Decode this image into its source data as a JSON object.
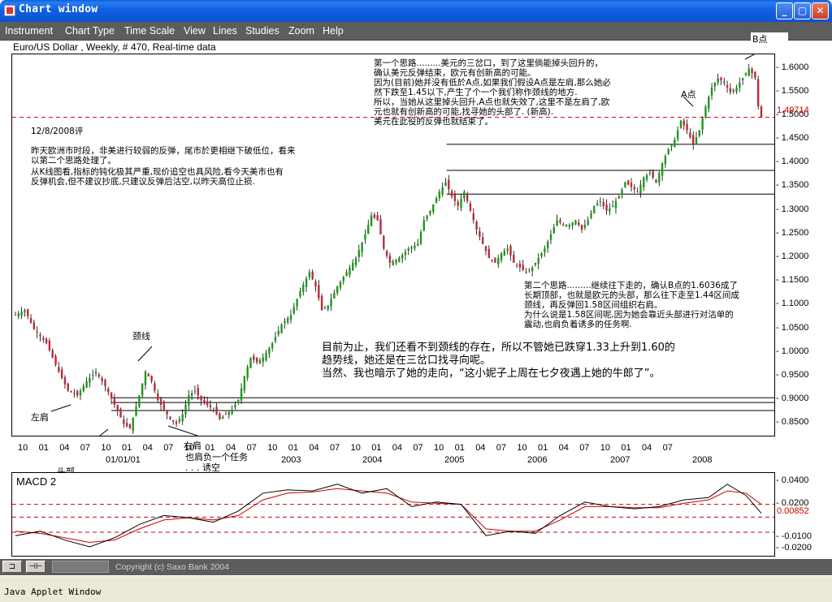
{
  "window": {
    "title": "Chart window",
    "minimize": "_",
    "maximize": "▢",
    "close": "✕"
  },
  "menu": [
    "Instrument",
    "Chart Type",
    "Time Scale",
    "View",
    "Lines",
    "Studies",
    "Zoom",
    "Help"
  ],
  "instrument_label": "Euro/US Dollar , Weekly, # 470, Real-time data",
  "chart_data": {
    "type": "candlestick",
    "instrument": "Euro/US Dollar",
    "period": "Weekly",
    "y_ticks": [
      "1.6000",
      "1.5500",
      "1.5000",
      "1.4500",
      "1.4000",
      "1.3500",
      "1.3000",
      "1.2500",
      "1.2000",
      "1.1500",
      "1.1000",
      "1.0500",
      "1.0000",
      "0.9500",
      "0.9000",
      "0.8500"
    ],
    "ylim": [
      0.825,
      1.63
    ],
    "current_price": "1.49714",
    "x_month_ticks": [
      "10",
      "01",
      "04",
      "07",
      "10",
      "01",
      "04",
      "07",
      "10",
      "01",
      "04",
      "07",
      "10",
      "01",
      "04",
      "07",
      "10",
      "01",
      "04",
      "07",
      "10",
      "01",
      "04",
      "07",
      "10",
      "01",
      "04",
      "07",
      "10",
      "01",
      "04",
      "07"
    ],
    "x_year_ticks": [
      "01/01/01",
      "2003",
      "2004",
      "2005",
      "2006",
      "2007",
      "2008"
    ],
    "x_range": [
      "2000-10",
      "2008-09"
    ],
    "price_path": [
      [
        0,
        1.08
      ],
      [
        3,
        1.09
      ],
      [
        6,
        1.05
      ],
      [
        10,
        1.02
      ],
      [
        14,
        0.96
      ],
      [
        17,
        0.92
      ],
      [
        20,
        0.91
      ],
      [
        23,
        0.94
      ],
      [
        26,
        0.96
      ],
      [
        29,
        0.93
      ],
      [
        32,
        0.89
      ],
      [
        35,
        0.85
      ],
      [
        37,
        0.84
      ],
      [
        40,
        0.91
      ],
      [
        42,
        0.96
      ],
      [
        44,
        0.94
      ],
      [
        46,
        0.9
      ],
      [
        48,
        0.88
      ],
      [
        50,
        0.86
      ],
      [
        52,
        0.85
      ],
      [
        54,
        0.87
      ],
      [
        56,
        0.91
      ],
      [
        58,
        0.92
      ],
      [
        60,
        0.9
      ],
      [
        62,
        0.89
      ],
      [
        64,
        0.88
      ],
      [
        66,
        0.86
      ],
      [
        68,
        0.87
      ],
      [
        70,
        0.88
      ],
      [
        72,
        0.9
      ],
      [
        74,
        0.95
      ],
      [
        76,
        0.99
      ],
      [
        78,
        0.98
      ],
      [
        80,
        0.99
      ],
      [
        83,
        1.02
      ],
      [
        86,
        1.06
      ],
      [
        89,
        1.08
      ],
      [
        92,
        1.13
      ],
      [
        95,
        1.17
      ],
      [
        97,
        1.14
      ],
      [
        99,
        1.09
      ],
      [
        101,
        1.1
      ],
      [
        104,
        1.14
      ],
      [
        107,
        1.17
      ],
      [
        110,
        1.2
      ],
      [
        113,
        1.25
      ],
      [
        115,
        1.29
      ],
      [
        117,
        1.28
      ],
      [
        119,
        1.22
      ],
      [
        121,
        1.19
      ],
      [
        124,
        1.2
      ],
      [
        127,
        1.22
      ],
      [
        130,
        1.23
      ],
      [
        132,
        1.28
      ],
      [
        134,
        1.3
      ],
      [
        137,
        1.34
      ],
      [
        139,
        1.36
      ],
      [
        141,
        1.33
      ],
      [
        143,
        1.31
      ],
      [
        145,
        1.34
      ],
      [
        147,
        1.3
      ],
      [
        149,
        1.26
      ],
      [
        151,
        1.23
      ],
      [
        153,
        1.2
      ],
      [
        155,
        1.19
      ],
      [
        157,
        1.21
      ],
      [
        159,
        1.22
      ],
      [
        161,
        1.19
      ],
      [
        163,
        1.18
      ],
      [
        165,
        1.17
      ],
      [
        167,
        1.18
      ],
      [
        169,
        1.2
      ],
      [
        171,
        1.22
      ],
      [
        173,
        1.25
      ],
      [
        175,
        1.28
      ],
      [
        177,
        1.27
      ],
      [
        179,
        1.27
      ],
      [
        181,
        1.28
      ],
      [
        183,
        1.26
      ],
      [
        185,
        1.28
      ],
      [
        187,
        1.31
      ],
      [
        189,
        1.32
      ],
      [
        191,
        1.3
      ],
      [
        193,
        1.31
      ],
      [
        195,
        1.33
      ],
      [
        197,
        1.36
      ],
      [
        199,
        1.35
      ],
      [
        201,
        1.34
      ],
      [
        203,
        1.37
      ],
      [
        205,
        1.38
      ],
      [
        207,
        1.36
      ],
      [
        209,
        1.4
      ],
      [
        211,
        1.43
      ],
      [
        213,
        1.45
      ],
      [
        215,
        1.49
      ],
      [
        217,
        1.47
      ],
      [
        219,
        1.44
      ],
      [
        221,
        1.47
      ],
      [
        223,
        1.52
      ],
      [
        225,
        1.56
      ],
      [
        227,
        1.58
      ],
      [
        229,
        1.57
      ],
      [
        231,
        1.55
      ],
      [
        233,
        1.56
      ],
      [
        235,
        1.58
      ],
      [
        237,
        1.6
      ],
      [
        239,
        1.58
      ],
      [
        240,
        1.52
      ],
      [
        241,
        1.49714
      ]
    ],
    "horizontal_lines": [
      {
        "from": 0.57,
        "to": 1.0,
        "y": 1.44
      },
      {
        "from": 0.57,
        "to": 1.0,
        "y": 1.385
      },
      {
        "from": 0.57,
        "to": 1.0,
        "y": 1.335
      },
      {
        "from": 0.13,
        "to": 1.0,
        "y": 0.905
      },
      {
        "from": 0.13,
        "to": 1.0,
        "y": 0.895
      },
      {
        "from": 0.13,
        "to": 1.0,
        "y": 0.878
      }
    ],
    "macd": {
      "title": "MACD 2",
      "y_ticks": [
        "0.0400",
        "0.0200",
        "-0.0100",
        "-0.0200"
      ],
      "ylim": [
        -0.026,
        0.048
      ],
      "dashed_levels": [
        0.02,
        0.00852,
        -0.005
      ],
      "current": "0.00852",
      "macd_line": [
        [
          0,
          -0.008
        ],
        [
          8,
          -0.004
        ],
        [
          16,
          -0.012
        ],
        [
          24,
          -0.018
        ],
        [
          32,
          -0.01
        ],
        [
          40,
          0.002
        ],
        [
          48,
          0.01
        ],
        [
          56,
          0.008
        ],
        [
          64,
          0.004
        ],
        [
          72,
          0.014
        ],
        [
          80,
          0.03
        ],
        [
          88,
          0.033
        ],
        [
          96,
          0.032
        ],
        [
          104,
          0.038
        ],
        [
          112,
          0.03
        ],
        [
          120,
          0.034
        ],
        [
          128,
          0.018
        ],
        [
          136,
          0.022
        ],
        [
          144,
          0.02
        ],
        [
          152,
          -0.008
        ],
        [
          160,
          -0.004
        ],
        [
          168,
          -0.006
        ],
        [
          176,
          0.01
        ],
        [
          184,
          0.022
        ],
        [
          192,
          0.018
        ],
        [
          200,
          0.016
        ],
        [
          208,
          0.018
        ],
        [
          216,
          0.024
        ],
        [
          224,
          0.026
        ],
        [
          230,
          0.038
        ],
        [
          236,
          0.028
        ],
        [
          241,
          0.012
        ]
      ],
      "signal_line": [
        [
          0,
          -0.004
        ],
        [
          8,
          -0.006
        ],
        [
          16,
          -0.01
        ],
        [
          24,
          -0.014
        ],
        [
          32,
          -0.012
        ],
        [
          40,
          -0.002
        ],
        [
          48,
          0.006
        ],
        [
          56,
          0.008
        ],
        [
          64,
          0.006
        ],
        [
          72,
          0.01
        ],
        [
          80,
          0.024
        ],
        [
          88,
          0.03
        ],
        [
          96,
          0.031
        ],
        [
          104,
          0.034
        ],
        [
          112,
          0.032
        ],
        [
          120,
          0.03
        ],
        [
          128,
          0.022
        ],
        [
          136,
          0.021
        ],
        [
          144,
          0.02
        ],
        [
          152,
          -0.002
        ],
        [
          160,
          -0.004
        ],
        [
          168,
          -0.004
        ],
        [
          176,
          0.006
        ],
        [
          184,
          0.018
        ],
        [
          192,
          0.018
        ],
        [
          200,
          0.017
        ],
        [
          208,
          0.017
        ],
        [
          216,
          0.021
        ],
        [
          224,
          0.024
        ],
        [
          230,
          0.032
        ],
        [
          236,
          0.03
        ],
        [
          241,
          0.02
        ]
      ]
    }
  },
  "annotations": {
    "date": "12/8/2008评",
    "intro_lines": [
      "    昨天欧洲市时段，非美进行较弱的反弹，尾市於更相继下破低位，看来",
      "以第二个思路处理了。",
      "    从K线图看,指标的钝化极其严重,现价追空也具风险,看今天美市也有",
      "反弹机会,但不建议抄底,只建议反弹后沽空,以昨天高位止损."
    ],
    "idea1_lines": [
      "第一个思路.........美元的三岔口，到了这里倘能掉头回升的，",
      "确认美元反弹结束，欧元有创新高的可能。",
      "因为(目前)她并没有低於A点,如果我们假设A点是左肩,那么她必",
      "然下跌至1.45以下,产生了个一个我们称作颈线的地方.",
      "所以，当她从这里掉头回升,A点也就失效了,这里不是左肩了,欧",
      "元也就有创新高的可能,找寻她的头部了. (新高).",
      "美元在此役的反弹也就结束了。"
    ],
    "idea2_lines": [
      "第二个思路.........继续往下走的，确认B点的1.6036成了",
      "长期顶部，也就是欧元的头部，那么往下走至1.44区间成",
      "颈线，再反弹回1.58区间组织右肩。",
      "为什么说是1.58区间呢,因为她会靠近头部进行对沽单的",
      "震动,也肩负着诱多的任务啊."
    ],
    "main_lines": [
      "目前为止，我们还看不到颈线的存在，所以不管她已跌穿1.33上升到1.60的",
      "趋势线，她还是在三岔口找寻向呢。",
      "当然、我也暗示了她的走向，“这小妮子上周在七夕夜遇上她的牛郎了”。"
    ],
    "label_neckline": "颈线",
    "label_left_shoulder": "左肩",
    "label_head": "头部",
    "label_right_shoulder": "右肩",
    "label_rs_note_1": "也肩负一个任务",
    "label_rs_note_2": ". . . 诱空",
    "label_a": "A点",
    "label_b": "B点"
  },
  "bottombar": {
    "btn1": "⊐",
    "btn2": "⊣⊢",
    "copyright": "Copyright (c) Saxo Bank 2004"
  },
  "status": "Java Applet Window"
}
